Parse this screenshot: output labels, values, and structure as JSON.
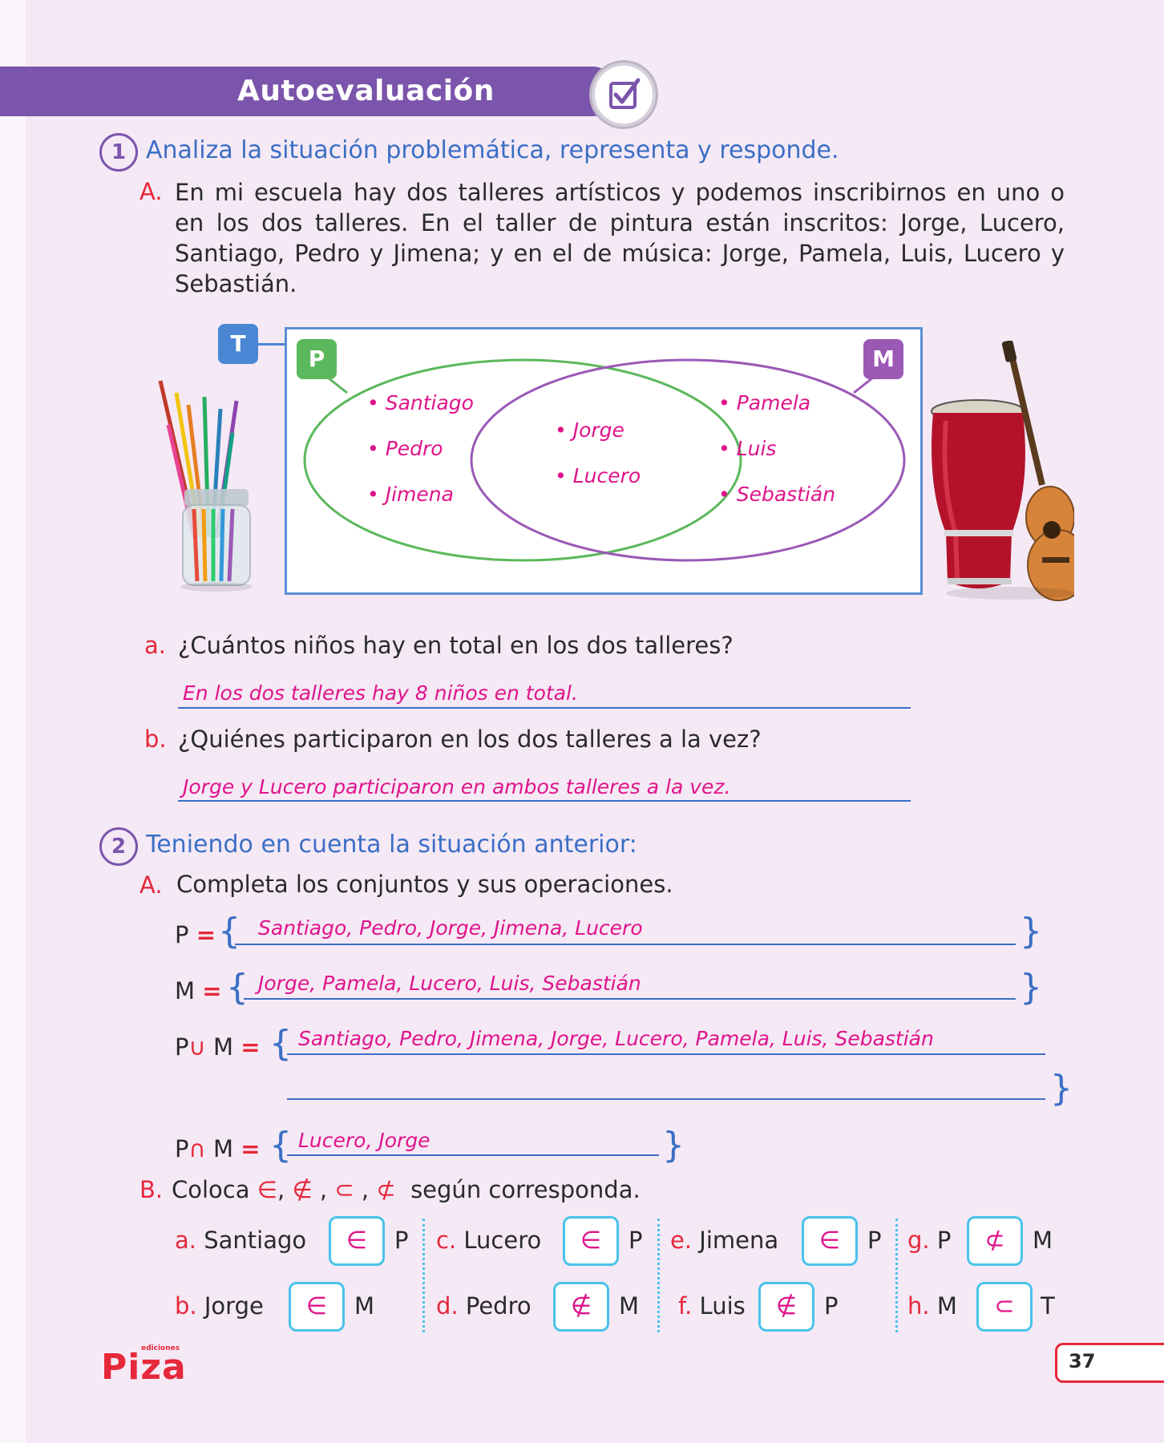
{
  "header": {
    "title": "Autoevaluación",
    "badge_icon": "checkbox-check-icon"
  },
  "q1": {
    "number": "1",
    "heading": "Analiza la situación problemática, representa y responde.",
    "A_letter": "A.",
    "A_text": "En mi escuela hay dos talleres artísticos y podemos inscribirnos en uno o en los dos talleres. En el taller de pintura están inscritos: Jorge, Lucero, Santiago, Pedro y Jimena; y en el de música: Jorge, Pamela, Luis, Lucero y Sebastián.",
    "venn": {
      "universe_label": "T",
      "set_p_label": "P",
      "set_m_label": "M",
      "only_p": [
        "Santiago",
        "Pedro",
        "Jimena"
      ],
      "both": [
        "Jorge",
        "Lucero"
      ],
      "only_m": [
        "Pamela",
        "Luis",
        "Sebastián"
      ],
      "colors": {
        "p": "#5cb85c",
        "m": "#9b59b6",
        "t": "#4a86d4"
      }
    },
    "a_letter": "a.",
    "a_question": "¿Cuántos niños hay en total en los dos talleres?",
    "a_answer": "En los dos talleres hay 8 niños en total.",
    "b_letter": "b.",
    "b_question": "¿Quiénes participaron en los dos talleres a la vez?",
    "b_answer": "Jorge y Lucero participaron en ambos talleres a la vez."
  },
  "q2": {
    "number": "2",
    "heading": "Teniendo en cuenta la situación anterior:",
    "A_letter": "A.",
    "A_text": "Completa los conjuntos y sus operaciones.",
    "sets": {
      "p_label": "P",
      "m_label": "M",
      "eq": "=",
      "union_sym": "∪",
      "inter_sym": "∩",
      "open": "{",
      "close": "}",
      "p_answer": "Santiago, Pedro, Jorge, Jimena, Lucero",
      "m_answer": "Jorge, Pamela, Lucero, Luis, Sebastián",
      "union_answer": "Santiago, Pedro, Jimena, Jorge, Lucero, Pamela, Luis, Sebastián",
      "inter_answer": "Lucero, Jorge"
    },
    "B_letter": "B.",
    "B_text_1": "Coloca",
    "B_symbols": [
      "∈",
      "∉",
      "⊂",
      "⊄"
    ],
    "B_text_2": "según corresponda.",
    "items": [
      {
        "letter": "a.",
        "left": "Santiago",
        "symbol": "∈",
        "right": "P"
      },
      {
        "letter": "b.",
        "left": "Jorge",
        "symbol": "∈",
        "right": "M"
      },
      {
        "letter": "c.",
        "left": "Lucero",
        "symbol": "∈",
        "right": "P"
      },
      {
        "letter": "d.",
        "left": "Pedro",
        "symbol": "∉",
        "right": "M"
      },
      {
        "letter": "e.",
        "left": "Jimena",
        "symbol": "∈",
        "right": "P"
      },
      {
        "letter": "f.",
        "left": "Luis",
        "symbol": "∉",
        "right": "P"
      },
      {
        "letter": "g.",
        "left": "P",
        "symbol": "⊄",
        "right": "M"
      },
      {
        "letter": "h.",
        "left": "M",
        "symbol": "⊂",
        "right": "T"
      }
    ]
  },
  "footer": {
    "logo": "Piza",
    "logo_small": "ediciones",
    "page_number": "37"
  }
}
